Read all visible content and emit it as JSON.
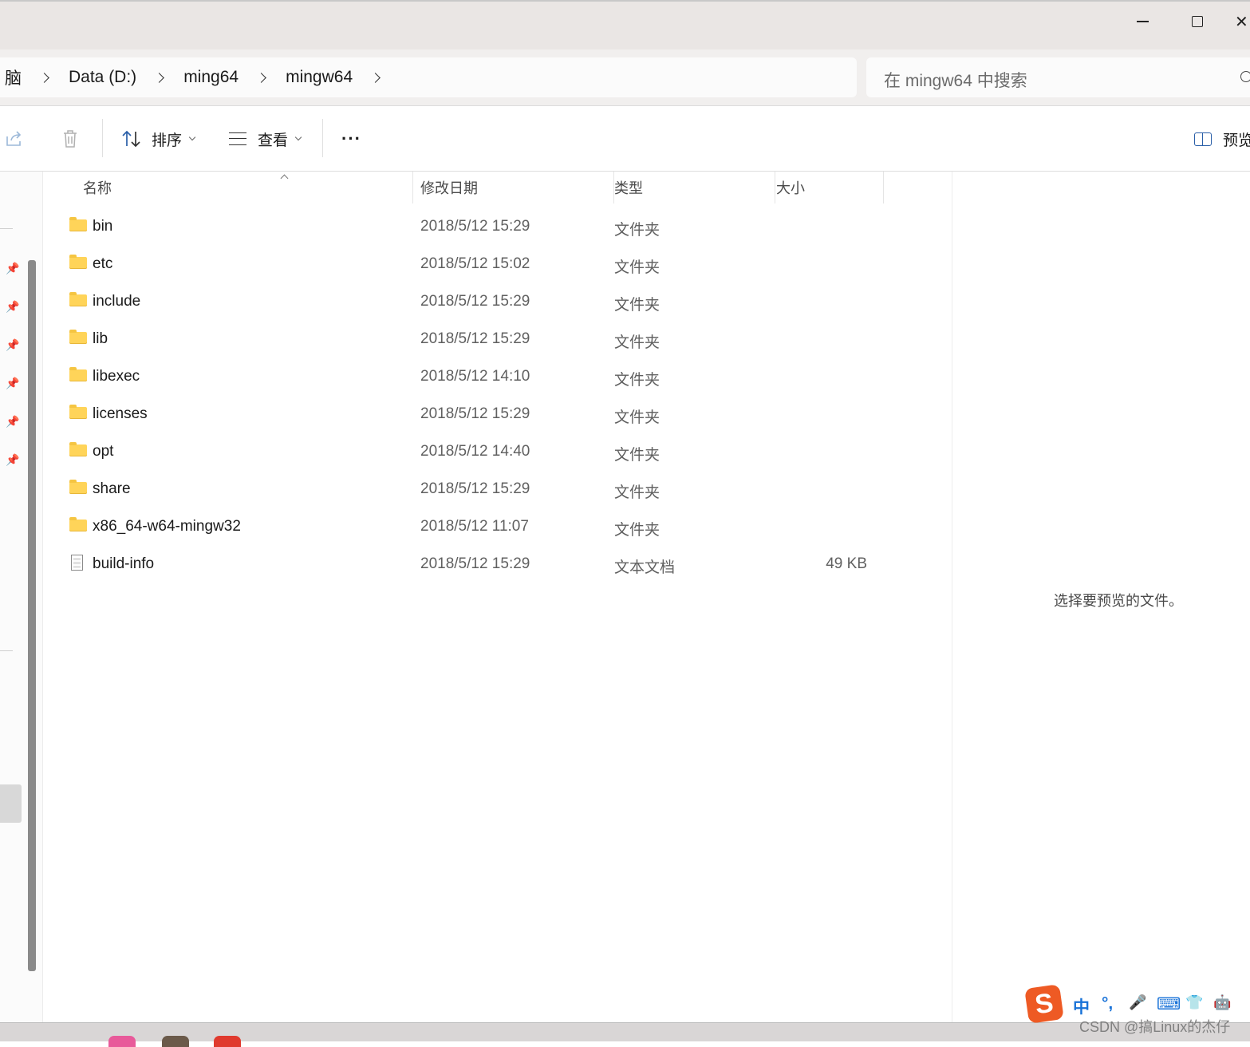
{
  "address": {
    "breadcrumbs": [
      "脑",
      "Data (D:)",
      "ming64",
      "mingw64"
    ]
  },
  "search": {
    "placeholder": "在 mingw64 中搜索"
  },
  "toolbar": {
    "sort_label": "排序",
    "view_label": "查看",
    "more_label": "···",
    "preview_label": "预览"
  },
  "columns": {
    "name": "名称",
    "date": "修改日期",
    "type": "类型",
    "size": "大小"
  },
  "files": [
    {
      "name": "bin",
      "date": "2018/5/12 15:29",
      "type": "文件夹",
      "size": "",
      "icon": "folder-icon"
    },
    {
      "name": "etc",
      "date": "2018/5/12 15:02",
      "type": "文件夹",
      "size": "",
      "icon": "folder-icon"
    },
    {
      "name": "include",
      "date": "2018/5/12 15:29",
      "type": "文件夹",
      "size": "",
      "icon": "folder-icon"
    },
    {
      "name": "lib",
      "date": "2018/5/12 15:29",
      "type": "文件夹",
      "size": "",
      "icon": "folder-icon"
    },
    {
      "name": "libexec",
      "date": "2018/5/12 14:10",
      "type": "文件夹",
      "size": "",
      "icon": "folder-icon"
    },
    {
      "name": "licenses",
      "date": "2018/5/12 15:29",
      "type": "文件夹",
      "size": "",
      "icon": "folder-icon"
    },
    {
      "name": "opt",
      "date": "2018/5/12 14:40",
      "type": "文件夹",
      "size": "",
      "icon": "folder-icon"
    },
    {
      "name": "share",
      "date": "2018/5/12 15:29",
      "type": "文件夹",
      "size": "",
      "icon": "folder-icon"
    },
    {
      "name": "x86_64-w64-mingw32",
      "date": "2018/5/12 11:07",
      "type": "文件夹",
      "size": "",
      "icon": "folder-icon"
    },
    {
      "name": "build-info",
      "date": "2018/5/12 15:29",
      "type": "文本文档",
      "size": "49 KB",
      "icon": "text-document-icon"
    }
  ],
  "preview": {
    "empty_message": "选择要预览的文件。"
  },
  "ime": {
    "logo": "S",
    "items": [
      "中",
      "°,",
      "🎤",
      "⌨",
      "👕",
      "🤖"
    ]
  },
  "watermark": "CSDN @搞Linux的杰仔",
  "colors": {
    "accent": "#2a5fa8",
    "folder": "#ffd459",
    "ime_brand": "#ee5a24",
    "ime_icons": "#1872d8"
  }
}
